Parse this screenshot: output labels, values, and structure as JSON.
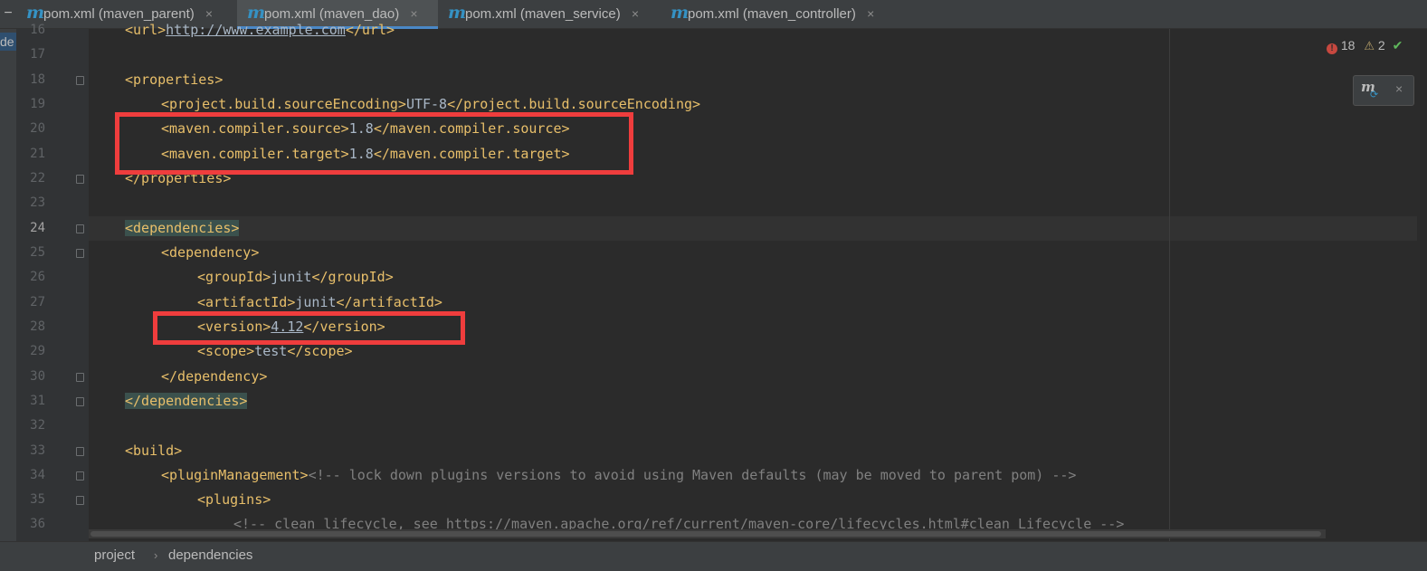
{
  "tabs": [
    {
      "icon": "m",
      "label": "pom.xml (maven_parent)",
      "active": false
    },
    {
      "icon": "m",
      "label": "pom.xml (maven_dao)",
      "active": true
    },
    {
      "icon": "m",
      "label": "pom.xml (maven_service)",
      "active": false
    },
    {
      "icon": "m",
      "label": "pom.xml (maven_controller)",
      "active": false
    }
  ],
  "tab_close_glyph": "×",
  "left_strip": {
    "stub": "−",
    "tag": "de"
  },
  "inspections": {
    "errors": "18",
    "warnings": "2",
    "error_glyph": "!",
    "warning_glyph": "⚠",
    "ok_glyph": "✔"
  },
  "maven_popup": {
    "icon": "m",
    "close": "×"
  },
  "line_numbers": [
    "16",
    "17",
    "18",
    "19",
    "20",
    "21",
    "22",
    "23",
    "24",
    "25",
    "26",
    "27",
    "28",
    "29",
    "30",
    "31",
    "32",
    "33",
    "34",
    "35",
    "36"
  ],
  "current_line": "24",
  "code": {
    "l16": {
      "open": "<url>",
      "text": "http://www.example.com",
      "close": "</url>"
    },
    "l18": {
      "tag": "<properties>"
    },
    "l19": {
      "open": "<project.build.sourceEncoding>",
      "text": "UTF-8",
      "close": "</project.build.sourceEncoding>"
    },
    "l20": {
      "open": "<maven.compiler.source>",
      "text": "1.8",
      "close": "</maven.compiler.source>"
    },
    "l21": {
      "open": "<maven.compiler.target>",
      "text": "1.8",
      "close": "</maven.compiler.target>"
    },
    "l22": {
      "tag": "</properties>"
    },
    "l24": {
      "tag": "<dependencies>"
    },
    "l25": {
      "tag": "<dependency>"
    },
    "l26": {
      "open": "<groupId>",
      "text": "junit",
      "close": "</groupId>"
    },
    "l27": {
      "open": "<artifactId>",
      "text": "junit",
      "close": "</artifactId>"
    },
    "l28": {
      "open": "<version>",
      "text": "4.12",
      "close": "</version>"
    },
    "l29": {
      "open": "<scope>",
      "text": "test",
      "close": "</scope>"
    },
    "l30": {
      "tag": "</dependency>"
    },
    "l31": {
      "tag": "</dependencies>"
    },
    "l33": {
      "tag": "<build>"
    },
    "l34": {
      "open": "<pluginManagement>",
      "comment": "<!-- lock down plugins versions to avoid using Maven defaults (may be moved to parent pom) -->"
    },
    "l35": {
      "tag": "<plugins>"
    },
    "l36": {
      "comment_pre": "<!-- clean lifecycle, see ",
      "url": "https://maven.apache.org/ref/current/maven-core/lifecycles.html#clean_Lifecycle",
      "comment_post": " -->"
    }
  },
  "breadcrumb": [
    "project",
    "dependencies"
  ],
  "breadcrumb_sep": "›",
  "colors": {
    "tag": "#e8bf6a",
    "text": "#a9b7c6",
    "comment": "#808080",
    "annotation_box": "#ef3d3d",
    "matched_tag": "#3b514d"
  }
}
